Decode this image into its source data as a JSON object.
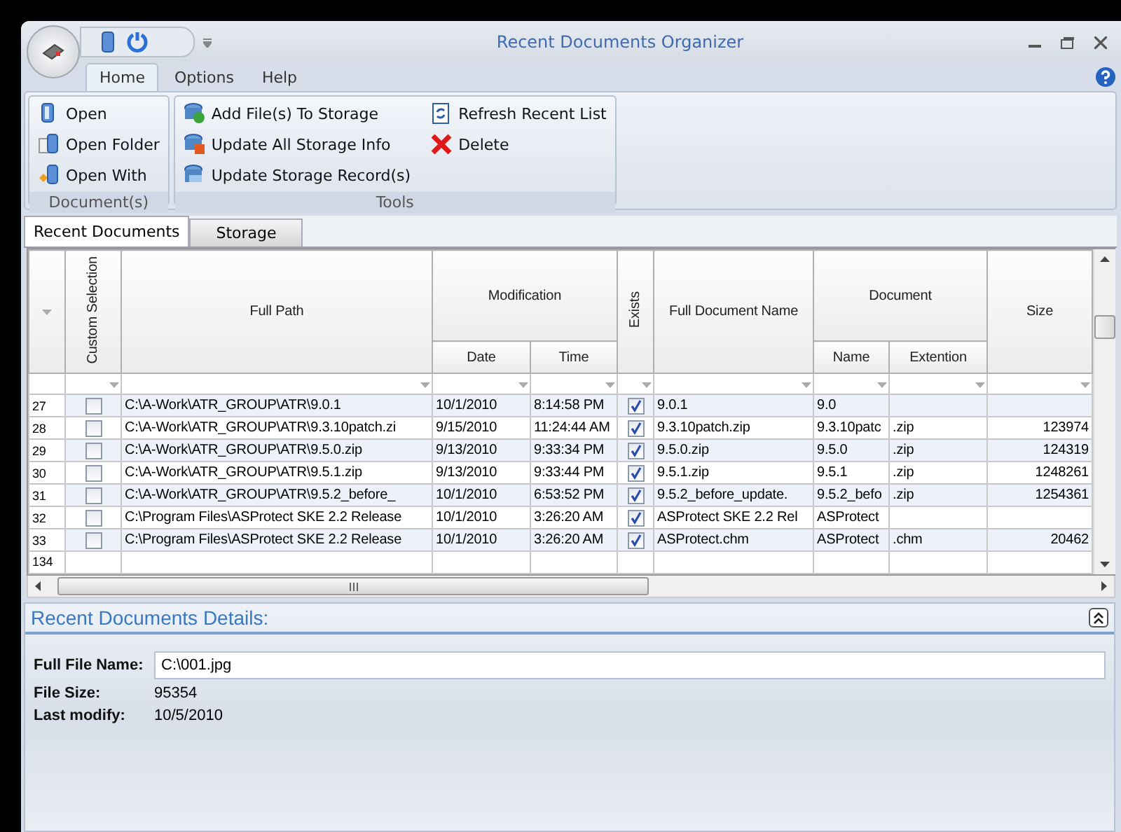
{
  "window": {
    "title": "Recent Documents Organizer"
  },
  "ribbon_tabs": [
    {
      "label": "Home",
      "selected": true
    },
    {
      "label": "Options",
      "selected": false
    },
    {
      "label": "Help",
      "selected": false
    }
  ],
  "ribbon_groups": [
    {
      "label": "Document(s)",
      "columns": [
        [
          "Open",
          "Open Folder",
          "Open With"
        ]
      ]
    },
    {
      "label": "Tools",
      "columns": [
        [
          "Add File(s) To Storage",
          "Update All Storage Info",
          "Update Storage Record(s)"
        ],
        [
          "Refresh Recent List",
          "Delete"
        ]
      ]
    }
  ],
  "document_tabs": [
    {
      "label": "Recent Documents",
      "selected": true
    },
    {
      "label": "Storage",
      "selected": false
    }
  ],
  "table": {
    "columns": [
      {
        "label": "Custom Selection",
        "kind": "vertical"
      },
      {
        "label": "Full Path",
        "kind": "plain"
      },
      {
        "label": "Modification",
        "kind": "group",
        "children": [
          "Date",
          "Time"
        ]
      },
      {
        "label": "Exists",
        "kind": "vertical"
      },
      {
        "label": "Full Document Name",
        "kind": "plain"
      },
      {
        "label": "Document",
        "kind": "group",
        "children": [
          "Name",
          "Extention"
        ]
      },
      {
        "label": "Size",
        "kind": "plain"
      }
    ],
    "rows": [
      {
        "number": "27",
        "custom_selection": false,
        "full_path": "C:\\A-Work\\ATR_GROUP\\ATR\\9.0.1",
        "date": "10/1/2010",
        "time": "8:14:58 PM",
        "exists": true,
        "full_document_name": "9.0.1",
        "name": "9.0",
        "extension": "",
        "size": ""
      },
      {
        "number": "28",
        "custom_selection": false,
        "full_path": "C:\\A-Work\\ATR_GROUP\\ATR\\9.3.10patch.zi",
        "date": "9/15/2010",
        "time": "11:24:44 AM",
        "exists": true,
        "full_document_name": "9.3.10patch.zip",
        "name": "9.3.10patc",
        "extension": ".zip",
        "size": "123974"
      },
      {
        "number": "29",
        "custom_selection": false,
        "full_path": "C:\\A-Work\\ATR_GROUP\\ATR\\9.5.0.zip",
        "date": "9/13/2010",
        "time": "9:33:34 PM",
        "exists": true,
        "full_document_name": "9.5.0.zip",
        "name": "9.5.0",
        "extension": ".zip",
        "size": "124319"
      },
      {
        "number": "30",
        "custom_selection": false,
        "full_path": "C:\\A-Work\\ATR_GROUP\\ATR\\9.5.1.zip",
        "date": "9/13/2010",
        "time": "9:33:44 PM",
        "exists": true,
        "full_document_name": "9.5.1.zip",
        "name": "9.5.1",
        "extension": ".zip",
        "size": "1248261"
      },
      {
        "number": "31",
        "custom_selection": false,
        "full_path": "C:\\A-Work\\ATR_GROUP\\ATR\\9.5.2_before_",
        "date": "10/1/2010",
        "time": "6:53:52 PM",
        "exists": true,
        "full_document_name": "9.5.2_before_update.",
        "name": "9.5.2_befo",
        "extension": ".zip",
        "size": "1254361"
      },
      {
        "number": "32",
        "custom_selection": false,
        "full_path": "C:\\Program Files\\ASProtect SKE 2.2 Release",
        "date": "10/1/2010",
        "time": "3:26:20 AM",
        "exists": true,
        "full_document_name": "ASProtect SKE 2.2 Rel",
        "name": "ASProtect",
        "extension": "",
        "size": ""
      },
      {
        "number": "33",
        "custom_selection": false,
        "full_path": "C:\\Program Files\\ASProtect SKE 2.2 Release",
        "date": "10/1/2010",
        "time": "3:26:20 AM",
        "exists": true,
        "full_document_name": "ASProtect.chm",
        "name": "ASProtect",
        "extension": ".chm",
        "size": "20462"
      },
      {
        "number": "134"
      }
    ]
  },
  "details": {
    "title": "Recent Documents Details:",
    "fields": [
      {
        "label": "Full File Name:",
        "value": "C:\\001.jpg",
        "kind": "input"
      },
      {
        "label": "File Size:",
        "value": "95354",
        "kind": "text"
      },
      {
        "label": "Last modify:",
        "value": "10/5/2010",
        "kind": "text"
      }
    ]
  }
}
